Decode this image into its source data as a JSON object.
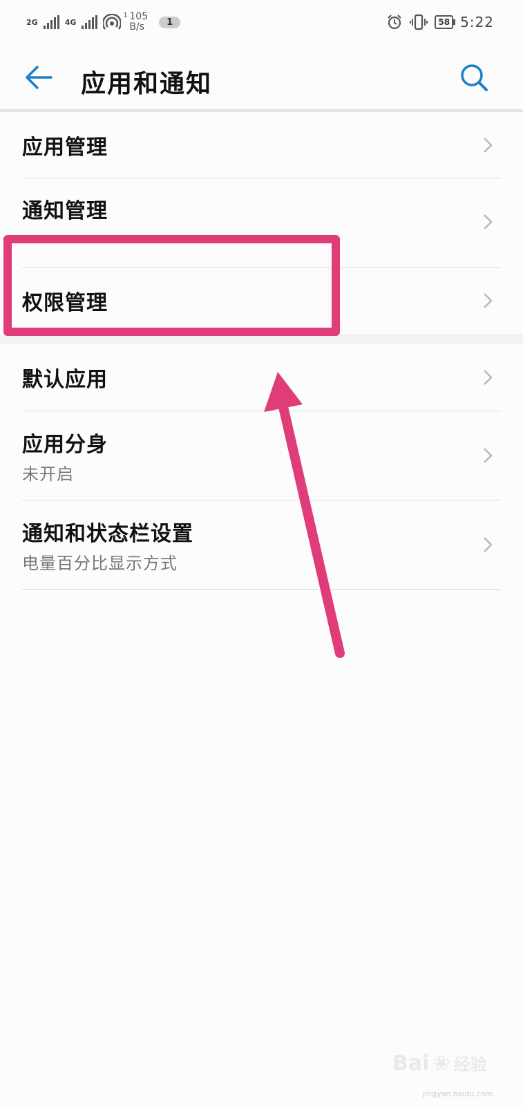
{
  "status_bar": {
    "net1": "2G",
    "net2": "4G",
    "speed_sup": "1",
    "speed_value": "105",
    "speed_unit": "B/s",
    "notification_count": "1",
    "battery": "58",
    "time": "5:22"
  },
  "header": {
    "title": "应用和通知"
  },
  "groups": [
    {
      "items": [
        {
          "label": "应用管理",
          "sub": ""
        },
        {
          "label": "通知管理",
          "sub": ""
        },
        {
          "label": "权限管理",
          "sub": ""
        }
      ]
    },
    {
      "items": [
        {
          "label": "默认应用",
          "sub": ""
        },
        {
          "label": "应用分身",
          "sub": "未开启"
        },
        {
          "label": "通知和状态栏设置",
          "sub": "电量百分比显示方式"
        }
      ]
    }
  ],
  "colors": {
    "accent": "#1a7fc9",
    "annotation": "#df3c79"
  },
  "watermark": {
    "brand": "Bai",
    "brand2": "经验",
    "url": "jingyan.baidu.com"
  }
}
